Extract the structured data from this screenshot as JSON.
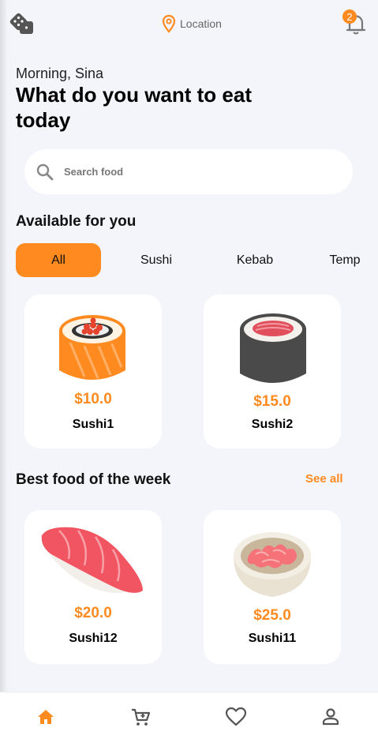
{
  "header": {
    "location_label": "Location",
    "notification_count": "2"
  },
  "greeting": "Morning, Sina",
  "headline": "What do you want to eat today",
  "search": {
    "placeholder": "Search food"
  },
  "available": {
    "title": "Available for you",
    "tabs": [
      {
        "label": "All",
        "active": true
      },
      {
        "label": "Sushi",
        "active": false
      },
      {
        "label": "Kebab",
        "active": false
      },
      {
        "label": "Temp",
        "active": false
      }
    ],
    "items": [
      {
        "price": "$10.0",
        "name": "Sushi1",
        "image_icon": "salmon-roll-icon"
      },
      {
        "price": "$15.0",
        "name": "Sushi2",
        "image_icon": "tuna-maki-icon"
      }
    ]
  },
  "best": {
    "title": "Best food of the week",
    "see_all": "See all",
    "items": [
      {
        "price": "$20.0",
        "name": "Sushi12",
        "image_icon": "nigiri-icon"
      },
      {
        "price": "$25.0",
        "name": "Sushi11",
        "image_icon": "ginger-bowl-icon"
      }
    ]
  },
  "bottom_nav": [
    "home-icon",
    "cart-icon",
    "heart-icon",
    "profile-icon"
  ],
  "colors": {
    "accent": "#FF8A1F",
    "background": "#F3F5FA"
  }
}
